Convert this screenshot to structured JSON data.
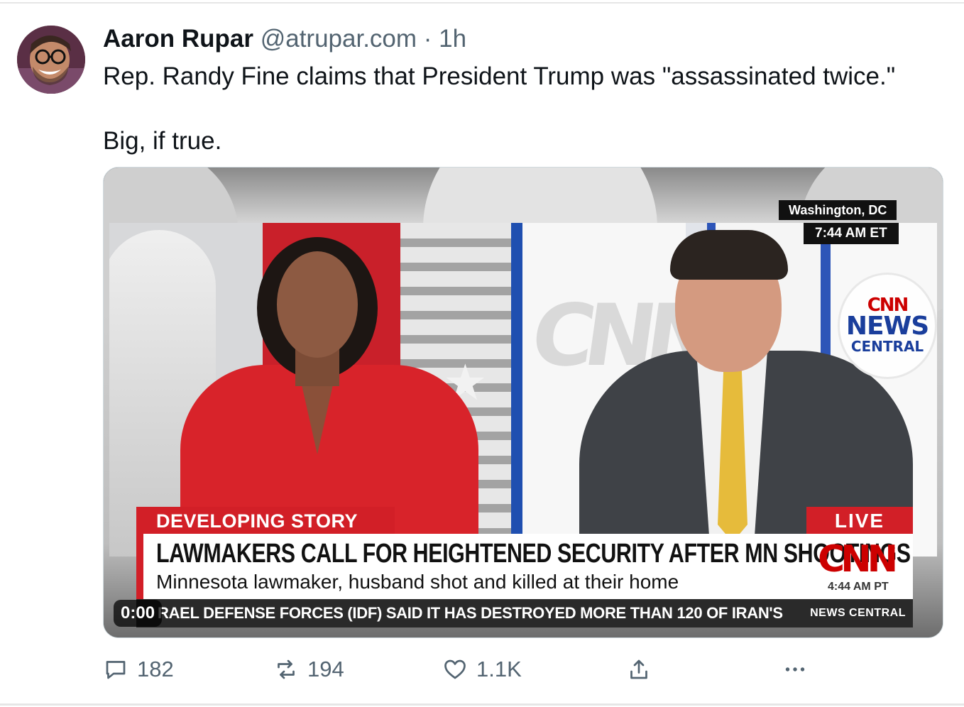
{
  "author": {
    "name": "Aaron Rupar",
    "handle": "@atrupar.com",
    "separator": "·",
    "time": "1h",
    "avatar_icon": "avatar-photo"
  },
  "post": {
    "line1": "Rep. Randy Fine claims that President Trump was \"assassinated twice.\"",
    "line2": "Big, if true."
  },
  "video": {
    "location": "Washington, DC",
    "local_time": "7:44 AM ET",
    "badge_cnn": "CNN",
    "badge_news": "NEWS",
    "badge_central": "CENTRAL",
    "developing_label": "DEVELOPING STORY",
    "live_label": "LIVE",
    "headline": "LAWMAKERS CALL FOR HEIGHTENED SECURITY AFTER MN SHOOTINGS",
    "subheadline": "Minnesota lawmaker, husband shot and killed at their home",
    "logo_text": "CNN",
    "pt_time": "4:44 AM PT",
    "ticker": "RAEL DEFENSE FORCES (IDF) SAID IT HAS DESTROYED MORE THAN 120 OF IRAN'S",
    "ticker_brand": "NEWS CENTRAL",
    "playback_time": "0:00",
    "colors": {
      "cnn_red": "#d21f27",
      "cnn_blue": "#1a3e9c"
    }
  },
  "actions": {
    "replies": "182",
    "reposts": "194",
    "likes": "1.1K",
    "icons": [
      "reply-icon",
      "repost-icon",
      "like-icon",
      "share-icon",
      "more-icon"
    ]
  },
  "colors": {
    "text": "#0f1419",
    "muted": "#536471"
  }
}
